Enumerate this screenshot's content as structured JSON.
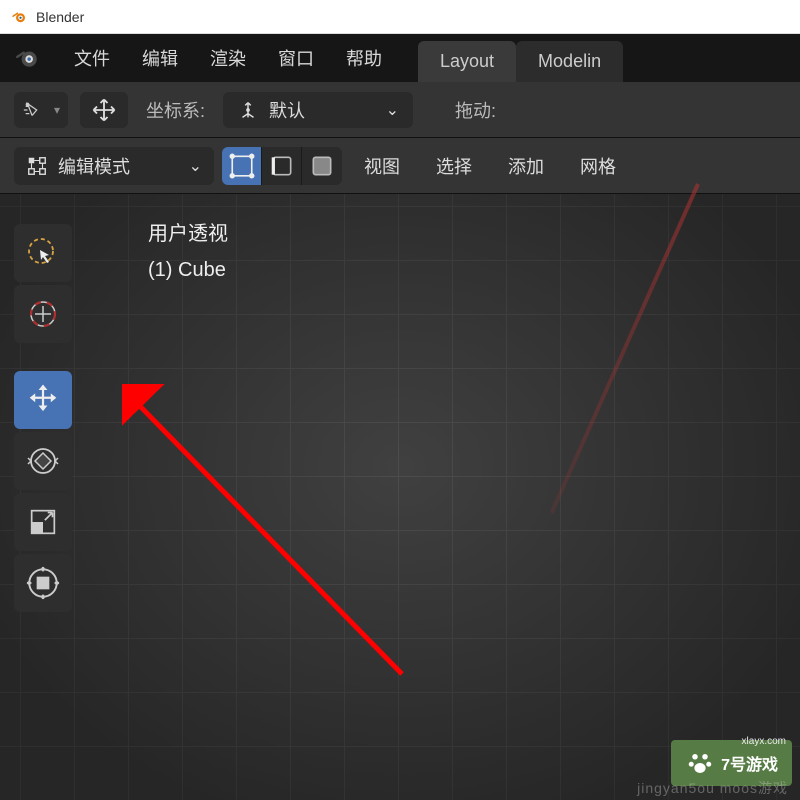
{
  "titlebar": {
    "app_name": "Blender"
  },
  "menubar": {
    "file": "文件",
    "edit": "编辑",
    "render": "渲染",
    "window": "窗口",
    "help": "帮助"
  },
  "workspaces": {
    "layout": "Layout",
    "modeling": "Modelin"
  },
  "toolbar1": {
    "coord_label": "坐标系:",
    "orientation": "默认",
    "drag_label": "拖动:"
  },
  "toolbar2": {
    "mode": "编辑模式",
    "view": "视图",
    "select": "选择",
    "add": "添加",
    "mesh": "网格"
  },
  "viewport": {
    "info_line1": "用户透视",
    "info_line2": "(1) Cube"
  },
  "watermark": {
    "text": "7号游戏",
    "url": "xlayx.com",
    "sub": "jingyan5ou moos游戏"
  }
}
